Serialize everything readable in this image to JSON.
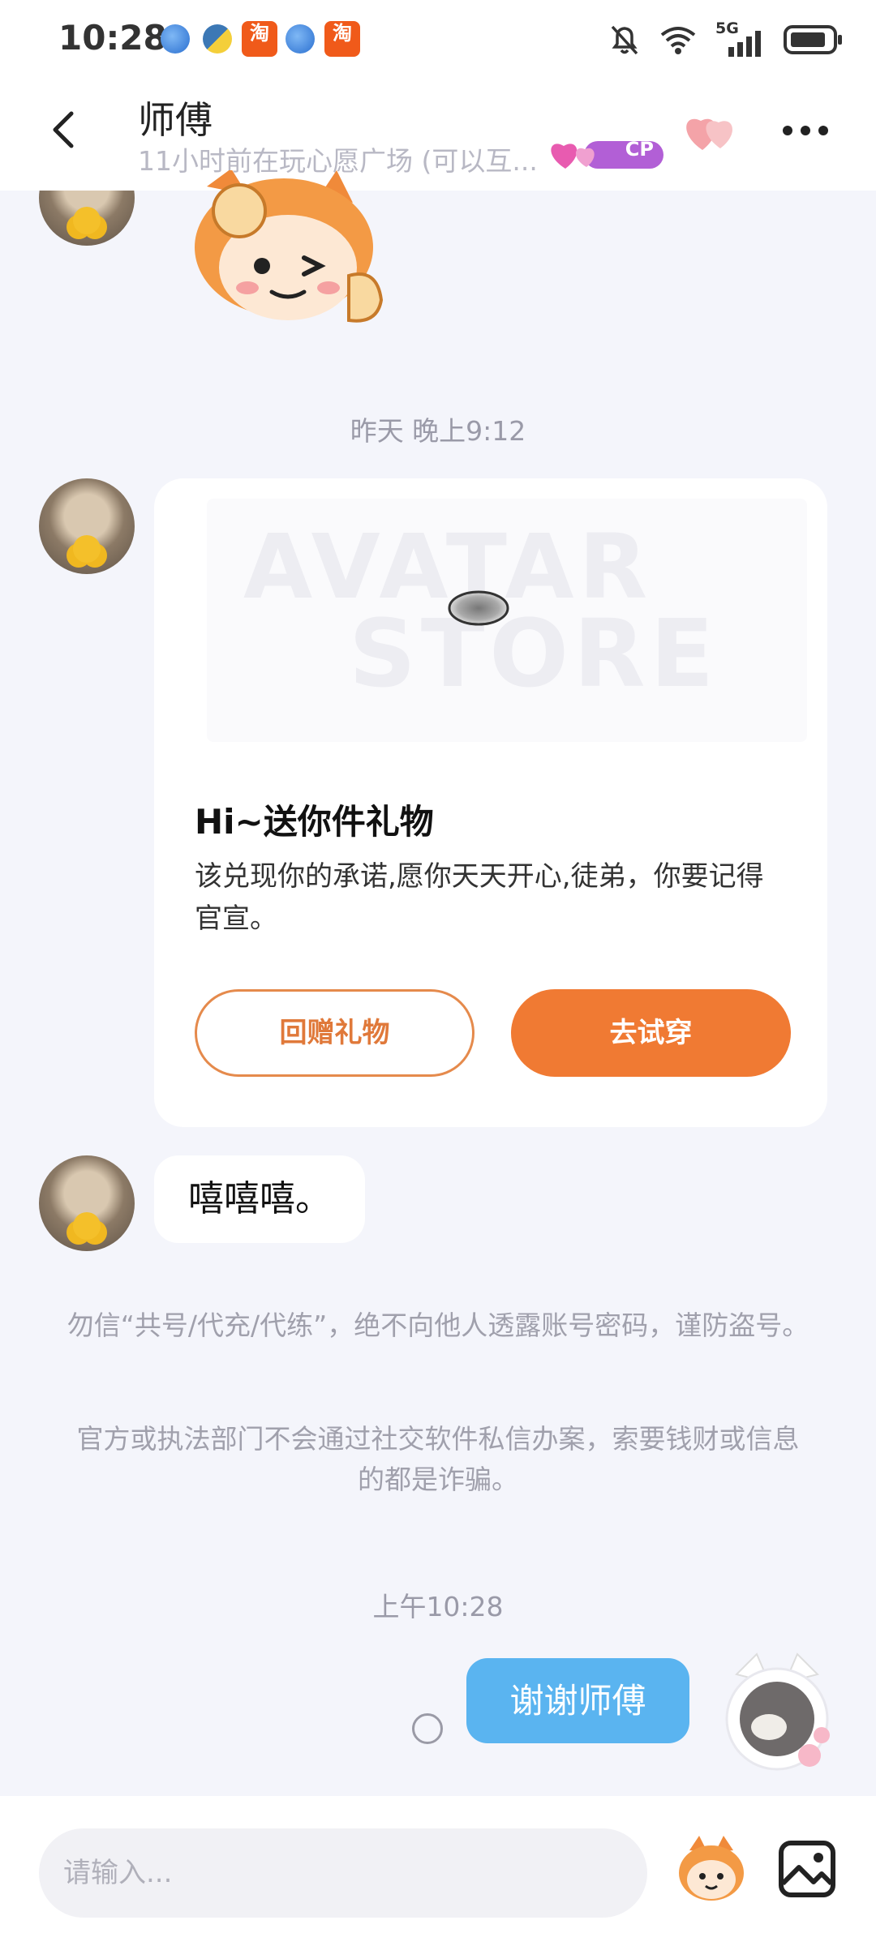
{
  "status_bar": {
    "time": "10:28",
    "network": "5G",
    "tao_label": "淘"
  },
  "header": {
    "title": "师傅",
    "subtitle": "11小时前在玩心愿广场 (可以互...",
    "badge": "CP"
  },
  "messages": {
    "time_yesterday": "昨天 晚上9:12",
    "gift_card": {
      "watermark_top": "AVATAR",
      "watermark_bottom": "STORE",
      "title": "Hi~送你件礼物",
      "description": "该兑现你的承诺,愿你天天开心,徒弟，你要记得官宣。",
      "return_gift_label": "回赠礼物",
      "try_on_label": "去试穿"
    },
    "incoming_text": "嘻嘻嘻。",
    "notice_1": "勿信“共号/代充/代练”，绝不向他人透露账号密码，谨防盗号。",
    "notice_2": "官方或执法部门不会通过社交软件私信办案，索要钱财或信息的都是诈骗。",
    "time_today": "上午10:28",
    "outgoing_text": "谢谢师傅"
  },
  "input_bar": {
    "placeholder": "请输入..."
  },
  "colors": {
    "accent_orange": "#f07a33",
    "bubble_blue": "#5ab4f0",
    "background": "#f4f5fb"
  }
}
